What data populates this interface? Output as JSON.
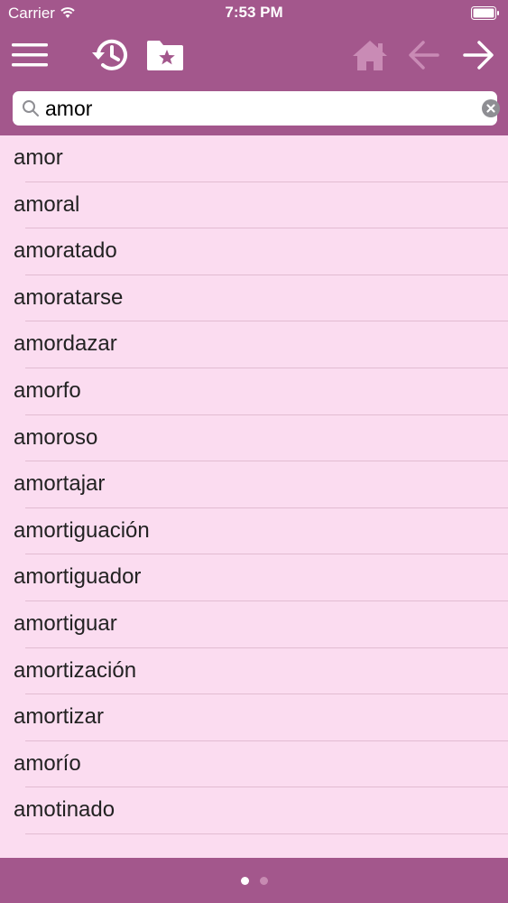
{
  "status_bar": {
    "carrier": "Carrier",
    "time": "7:53 PM",
    "icons": [
      "wifi-icon",
      "battery-icon"
    ]
  },
  "toolbar": {
    "buttons": [
      {
        "name": "menu",
        "icon": "hamburger-menu-icon",
        "enabled": true
      },
      {
        "name": "history",
        "icon": "history-clock-icon",
        "enabled": true
      },
      {
        "name": "bookmarks",
        "icon": "folder-star-icon",
        "enabled": true
      },
      {
        "name": "home",
        "icon": "home-icon",
        "enabled": false
      },
      {
        "name": "back",
        "icon": "arrow-left-icon",
        "enabled": false
      },
      {
        "name": "forward",
        "icon": "arrow-right-icon",
        "enabled": true
      }
    ]
  },
  "search": {
    "value": "amor",
    "placeholder": ""
  },
  "word_list": [
    "amor",
    "amoral",
    "amoratado",
    "amoratarse",
    "amordazar",
    "amorfo",
    "amoroso",
    "amortajar",
    "amortiguación",
    "amortiguador",
    "amortiguar",
    "amortización",
    "amortizar",
    "amorío",
    "amotinado"
  ],
  "pagination": {
    "total_pages": 2,
    "current_page": 1
  },
  "colors": {
    "header": "#a3578c",
    "list_background": "#fbdcf0",
    "icon_active": "#ffffff",
    "icon_disabled": "#c98bb5"
  }
}
